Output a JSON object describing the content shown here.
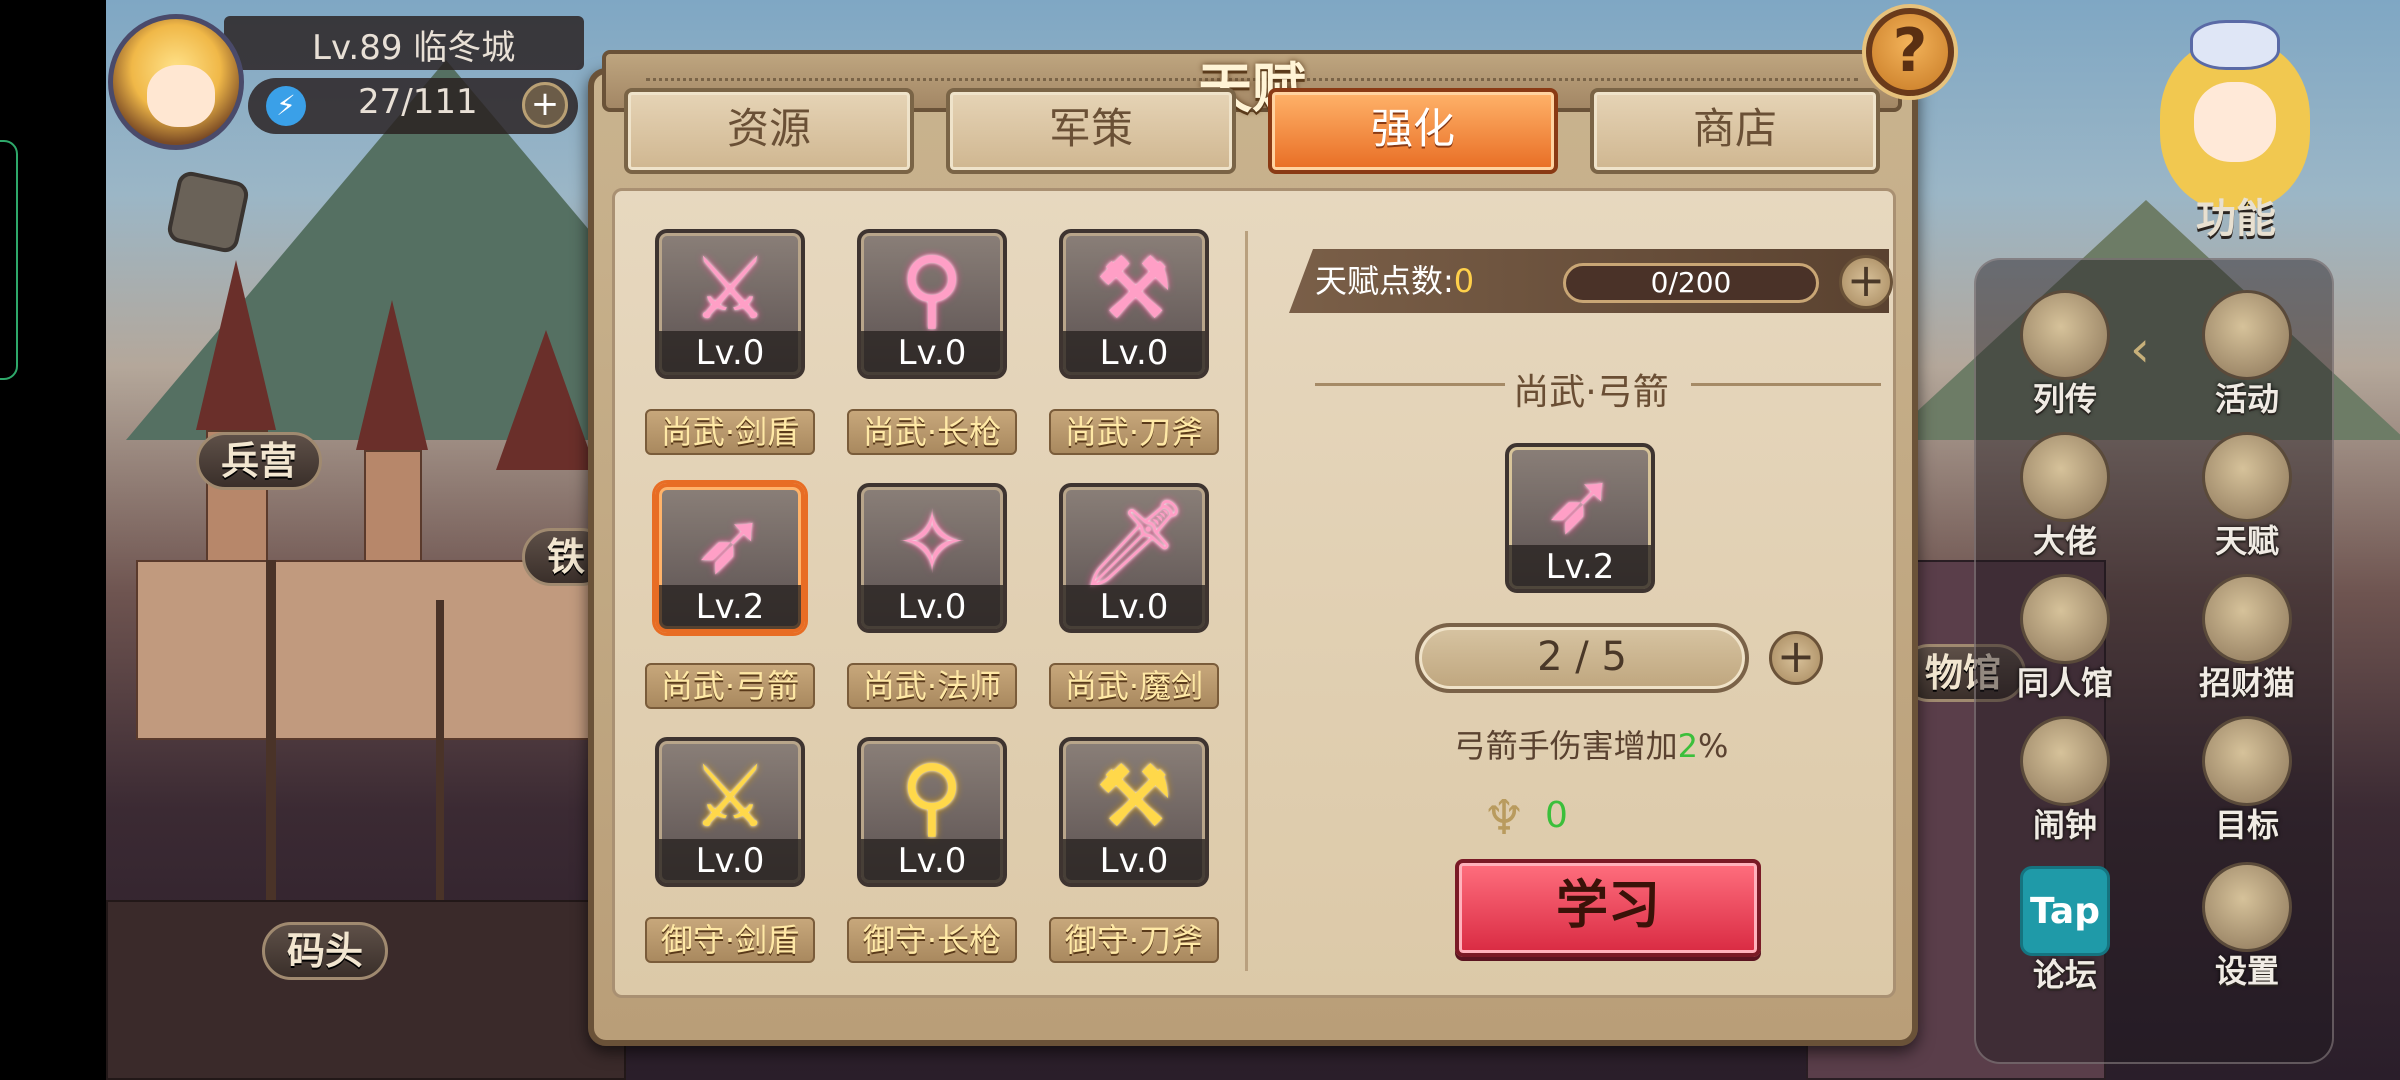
{
  "player": {
    "level_city": "Lv.89  临冬城",
    "energy": "27/111"
  },
  "scene_labels": {
    "barracks": "兵营",
    "dock": "码头",
    "partial_left": "铁",
    "partial_right": "物馆"
  },
  "window": {
    "title": "天赋",
    "tabs": [
      {
        "label": "资源"
      },
      {
        "label": "军策"
      },
      {
        "label": "强化",
        "active": true
      },
      {
        "label": "商店"
      }
    ]
  },
  "talents": [
    {
      "name": "尚武·剑盾",
      "level": "Lv.0",
      "icon": "sword-shield-icon"
    },
    {
      "name": "尚武·长枪",
      "level": "Lv.0",
      "icon": "spear-icon"
    },
    {
      "name": "尚武·刀斧",
      "level": "Lv.0",
      "icon": "axe-icon"
    },
    {
      "name": "尚武·弓箭",
      "level": "Lv.2",
      "icon": "bow-icon",
      "selected": true
    },
    {
      "name": "尚武·法师",
      "level": "Lv.0",
      "icon": "staff-icon"
    },
    {
      "name": "尚武·魔剑",
      "level": "Lv.0",
      "icon": "magic-sword-icon"
    },
    {
      "name": "御守·剑盾",
      "level": "Lv.0",
      "icon": "sword-shield-icon"
    },
    {
      "name": "御守·长枪",
      "level": "Lv.0",
      "icon": "spear-icon"
    },
    {
      "name": "御守·刀斧",
      "level": "Lv.0",
      "icon": "axe-icon"
    }
  ],
  "detail": {
    "points_label": "天赋点数:",
    "points_value": "0",
    "points_progress": "0/200",
    "selected_name": "尚武·弓箭",
    "selected_level": "Lv.2",
    "level_progress": "2 / 5",
    "desc_prefix": "弓箭手伤害增加",
    "desc_value": "2",
    "desc_suffix": "%",
    "cost": "0",
    "learn_label": "学习"
  },
  "side_menu": {
    "function_label": "功能",
    "items": [
      {
        "label": "列传"
      },
      {
        "label": "活动"
      },
      {
        "label": "大佬"
      },
      {
        "label": "天赋"
      },
      {
        "label": "同人馆"
      },
      {
        "label": "招财猫"
      },
      {
        "label": "闹钟"
      },
      {
        "label": "目标"
      },
      {
        "label": "论坛",
        "badge": "Tap"
      },
      {
        "label": "设置"
      }
    ]
  },
  "colors": {
    "accent_orange": "#e86d24",
    "learn_red": "#d92a42",
    "green_value": "#3bbf3b"
  }
}
